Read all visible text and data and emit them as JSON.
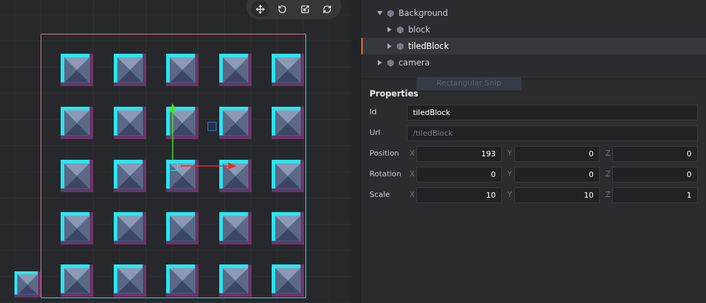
{
  "toolbar": [
    {
      "kind": "move",
      "selected": true
    },
    {
      "kind": "rotate",
      "selected": false
    },
    {
      "kind": "scale",
      "selected": false
    },
    {
      "kind": "reset",
      "selected": false
    }
  ],
  "tree": [
    {
      "label": "Background",
      "expanded": true,
      "selected": false,
      "children": [
        {
          "label": "block",
          "expanded": false,
          "selected": false
        },
        {
          "label": "tiledBlock",
          "expanded": false,
          "selected": true
        }
      ]
    },
    {
      "label": "camera",
      "expanded": false,
      "selected": false
    }
  ],
  "snip_overlay": "Rectangular Snip",
  "properties": {
    "title": "Properties",
    "fields": [
      {
        "label": "Id",
        "value": "tiledBlock",
        "disabled": false
      },
      {
        "label": "Url",
        "value": "/tiledBlock",
        "disabled": true
      }
    ],
    "vectors": [
      {
        "label": "Position",
        "components": [
          {
            "axis": "X",
            "value": "193"
          },
          {
            "axis": "Y",
            "value": "0"
          },
          {
            "axis": "Z",
            "value": "0"
          }
        ]
      },
      {
        "label": "Rotation",
        "components": [
          {
            "axis": "X",
            "value": "0"
          },
          {
            "axis": "Y",
            "value": "0"
          },
          {
            "axis": "Z",
            "value": "0"
          }
        ]
      },
      {
        "label": "Scale",
        "components": [
          {
            "axis": "X",
            "value": "10"
          },
          {
            "axis": "Y",
            "value": "10"
          },
          {
            "axis": "Z",
            "value": "1"
          }
        ]
      }
    ]
  }
}
